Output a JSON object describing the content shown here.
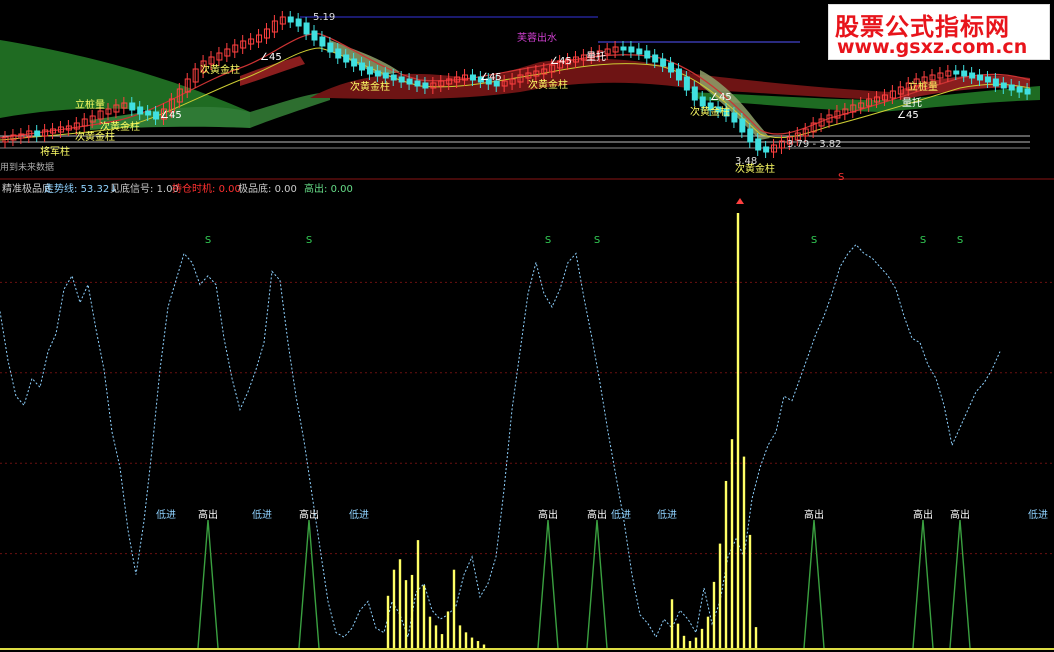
{
  "watermark": {
    "title": "股票公式指标网",
    "url": "www.gsxz.com.cn"
  },
  "upper_labels": {
    "price_high": "5.19",
    "pass_water": "芙蓉出水",
    "gold_pillar": "次黄金柱",
    "gold_pillar_2": "次黄金柱",
    "gold_pillar_3": "次黄金柱",
    "gold_pillar_4": "次黄金柱",
    "gold_pillar_5": "次黄金柱",
    "gold_pillar_6": "次黄金柱",
    "angle_1": "∠45",
    "angle_2": "∠45",
    "angle_3": "∠45",
    "angle_4": "∠45",
    "angle_5": "∠45",
    "angle_6": "∠45",
    "support_1": "量托",
    "support_2": "量托",
    "stand_1": "立桩量",
    "stand_2": "立桩量",
    "general": "将军柱",
    "range": "3.79 - 3.82",
    "price_low": "3.48",
    "future_note": "用到未来数据",
    "marker_s": "S"
  },
  "indicator_header": {
    "name": "精准极品底",
    "items": [
      {
        "label": "走势线:",
        "value": "53.32↓",
        "color": "#8fd2ff"
      },
      {
        "label": "见底信号:",
        "value": "1.00",
        "color": "#cccccc"
      },
      {
        "label": "持仓时机:",
        "value": "0.00",
        "color": "#ff3030"
      },
      {
        "label": "极品底:",
        "value": "0.00",
        "color": "#cccccc"
      },
      {
        "label": "高出:",
        "value": "0.00",
        "color": "#66dd88"
      }
    ]
  },
  "signal_labels": {
    "sell": "S",
    "high": "高出",
    "low": "低进"
  },
  "chart_data": [
    {
      "type": "candlestick",
      "title": "",
      "annotations": [
        "5.19",
        "3.48",
        "3.79 - 3.82"
      ],
      "price_range": [
        3.48,
        5.19
      ]
    },
    {
      "type": "line",
      "title": "精准极品底",
      "xlabel": "",
      "ylabel": "",
      "ylim": [
        0,
        100
      ],
      "x": [
        0,
        8,
        16,
        24,
        32,
        40,
        48,
        56,
        64,
        72,
        80,
        88,
        96,
        104,
        112,
        120,
        128,
        136,
        144,
        152,
        160,
        168,
        176,
        184,
        192,
        200,
        208,
        216,
        224,
        232,
        240,
        248,
        256,
        264,
        272,
        280,
        288,
        296,
        304,
        312,
        320,
        328,
        336,
        344,
        352,
        360,
        368,
        376,
        384,
        392,
        400,
        408,
        416,
        424,
        432,
        440,
        448,
        456,
        464,
        472,
        480,
        488,
        496,
        504,
        512,
        520,
        528,
        536,
        544,
        552,
        560,
        568,
        576,
        584,
        592,
        600,
        608,
        616,
        624,
        632,
        640,
        648,
        656,
        664,
        672,
        680,
        688,
        696,
        704,
        712,
        720,
        728,
        736,
        744,
        752,
        760,
        768,
        776,
        784,
        792,
        800,
        808,
        816,
        824,
        832,
        840,
        848,
        856,
        864,
        872,
        880,
        888,
        896,
        904,
        912,
        920,
        928,
        936,
        944,
        952,
        960,
        968,
        976,
        984,
        992,
        1000,
        1008,
        1016,
        1024,
        1030
      ],
      "series": [
        {
          "values": [
            75,
            64,
            56,
            54,
            60,
            58,
            66,
            70,
            80,
            83,
            77,
            81,
            71,
            62,
            48,
            40,
            26,
            16,
            28,
            44,
            62,
            76,
            82,
            88,
            86,
            81,
            83,
            81,
            69,
            60,
            53,
            57,
            62,
            68,
            84,
            82,
            68,
            56,
            46,
            34,
            22,
            10,
            3,
            2,
            4,
            8,
            10,
            4,
            3,
            10,
            7,
            2,
            12,
            14,
            8,
            6,
            7,
            9,
            16,
            20,
            11,
            14,
            20,
            35,
            53,
            66,
            79,
            86,
            79,
            76,
            80,
            86,
            88,
            78,
            69,
            59,
            48,
            38,
            28,
            16,
            7,
            5,
            2,
            6,
            4,
            8,
            6,
            3,
            13,
            5,
            10,
            20,
            24,
            20,
            33,
            40,
            45,
            48,
            56,
            55,
            60,
            65,
            70,
            74,
            79,
            85,
            88,
            90,
            88,
            87,
            85,
            83,
            80,
            74,
            69,
            68,
            63,
            60,
            54,
            45,
            49,
            53,
            57,
            59,
            62,
            66
          ]
        },
        {
          "name": "见底信号",
          "type": "bar",
          "x": [
            388,
            394,
            400,
            406,
            412,
            418,
            424,
            430,
            436,
            442,
            448,
            454,
            460,
            466,
            472,
            478,
            484,
            672,
            678,
            684,
            690,
            696,
            702,
            708,
            714,
            720,
            726,
            732,
            738,
            744,
            750,
            756
          ],
          "values": [
            30,
            45,
            51,
            39,
            42,
            62,
            36,
            18,
            13,
            8,
            21,
            45,
            13,
            9,
            6,
            4,
            2,
            28,
            14,
            7,
            4,
            6,
            11,
            18,
            38,
            60,
            96,
            120,
            250,
            110,
            65,
            12
          ]
        }
      ],
      "signals": {
        "sell_S": [
          208,
          309,
          548,
          597,
          814,
          923,
          960
        ],
        "high": [
          208,
          309,
          548,
          597,
          814,
          923,
          960
        ],
        "low": [
          166,
          262,
          359,
          621,
          667,
          1038
        ]
      }
    }
  ]
}
